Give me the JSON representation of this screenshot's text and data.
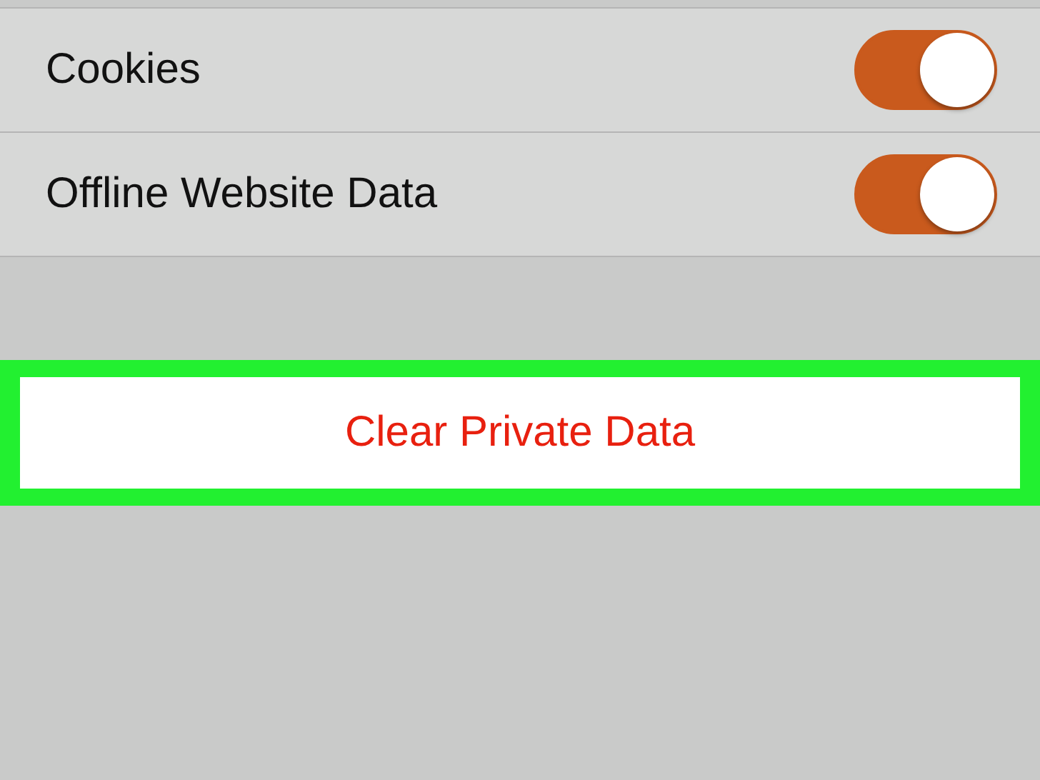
{
  "settings": [
    {
      "label": "Cookies",
      "on": true
    },
    {
      "label": "Offline Website Data",
      "on": true
    }
  ],
  "clear_button": {
    "label": "Clear Private Data",
    "highlighted": true
  }
}
